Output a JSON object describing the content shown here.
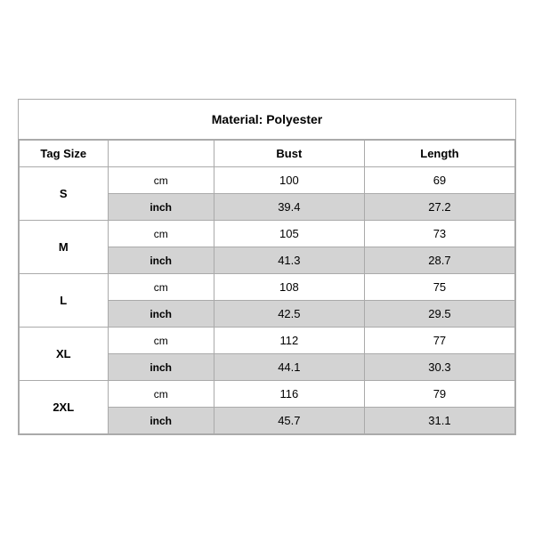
{
  "title": "Material: Polyester",
  "columns": {
    "tag_size": "Tag Size",
    "bust": "Bust",
    "length": "Length"
  },
  "sizes": [
    {
      "tag": "S",
      "cm": {
        "bust": "100",
        "length": "69"
      },
      "inch": {
        "bust": "39.4",
        "length": "27.2"
      }
    },
    {
      "tag": "M",
      "cm": {
        "bust": "105",
        "length": "73"
      },
      "inch": {
        "bust": "41.3",
        "length": "28.7"
      }
    },
    {
      "tag": "L",
      "cm": {
        "bust": "108",
        "length": "75"
      },
      "inch": {
        "bust": "42.5",
        "length": "29.5"
      }
    },
    {
      "tag": "XL",
      "cm": {
        "bust": "112",
        "length": "77"
      },
      "inch": {
        "bust": "44.1",
        "length": "30.3"
      }
    },
    {
      "tag": "2XL",
      "cm": {
        "bust": "116",
        "length": "79"
      },
      "inch": {
        "bust": "45.7",
        "length": "31.1"
      }
    }
  ],
  "units": {
    "cm": "cm",
    "inch": "inch"
  }
}
